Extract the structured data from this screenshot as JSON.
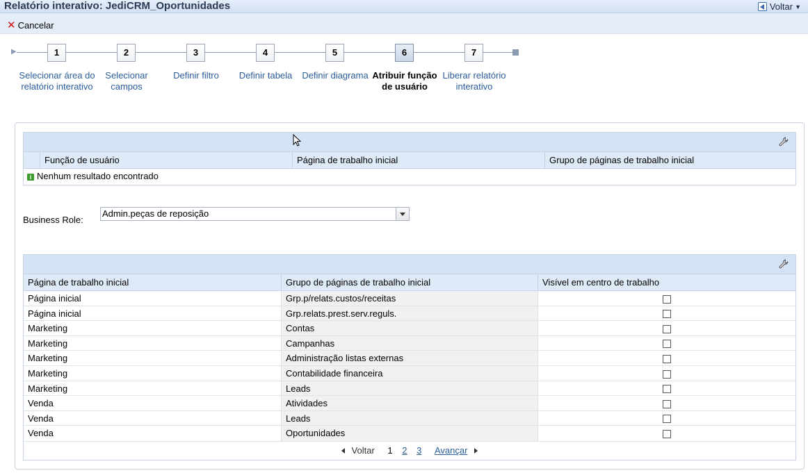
{
  "window": {
    "title": "Relatório interativo: JediCRM_Oportunidades",
    "back_label": "Voltar"
  },
  "toolbar": {
    "cancel_label": "Cancelar"
  },
  "wizard": {
    "active_step": 6,
    "steps": [
      {
        "number": "1",
        "label": "Selecionar área do relatório interativo"
      },
      {
        "number": "2",
        "label": "Selecionar campos"
      },
      {
        "number": "3",
        "label": "Definir filtro"
      },
      {
        "number": "4",
        "label": "Definir tabela"
      },
      {
        "number": "5",
        "label": "Definir diagrama"
      },
      {
        "number": "6",
        "label": "Atribuir função de usuário"
      },
      {
        "number": "7",
        "label": "Liberar relatório interativo"
      }
    ]
  },
  "roles_table": {
    "columns": [
      "Função de usuário",
      "Página de trabalho inicial",
      "Grupo de páginas de trabalho inicial"
    ],
    "empty_message": "Nenhum resultado encontrado"
  },
  "business_role": {
    "label": "Business Role:",
    "selected": "Admin.peças de reposição"
  },
  "pages_table": {
    "columns": [
      "Página de trabalho inicial",
      "Grupo de páginas de trabalho inicial",
      "Visível em centro de trabalho"
    ],
    "rows": [
      {
        "page": "Página inicial",
        "group": "Grp.p/relats.custos/receitas",
        "visible": false
      },
      {
        "page": "Página inicial",
        "group": "Grp.relats.prest.serv.reguls.",
        "visible": false
      },
      {
        "page": "Marketing",
        "group": "Contas",
        "visible": false
      },
      {
        "page": "Marketing",
        "group": "Campanhas",
        "visible": false
      },
      {
        "page": "Marketing",
        "group": "Administração listas externas",
        "visible": false
      },
      {
        "page": "Marketing",
        "group": "Contabilidade financeira",
        "visible": false
      },
      {
        "page": "Marketing",
        "group": "Leads",
        "visible": false
      },
      {
        "page": "Venda",
        "group": "Atividades",
        "visible": false
      },
      {
        "page": "Venda",
        "group": "Leads",
        "visible": false
      },
      {
        "page": "Venda",
        "group": "Oportunidades",
        "visible": false
      }
    ]
  },
  "pager": {
    "prev_label": "Voltar",
    "pages": [
      "1",
      "2",
      "3"
    ],
    "current_page": "1",
    "next_label": "Avançar"
  }
}
